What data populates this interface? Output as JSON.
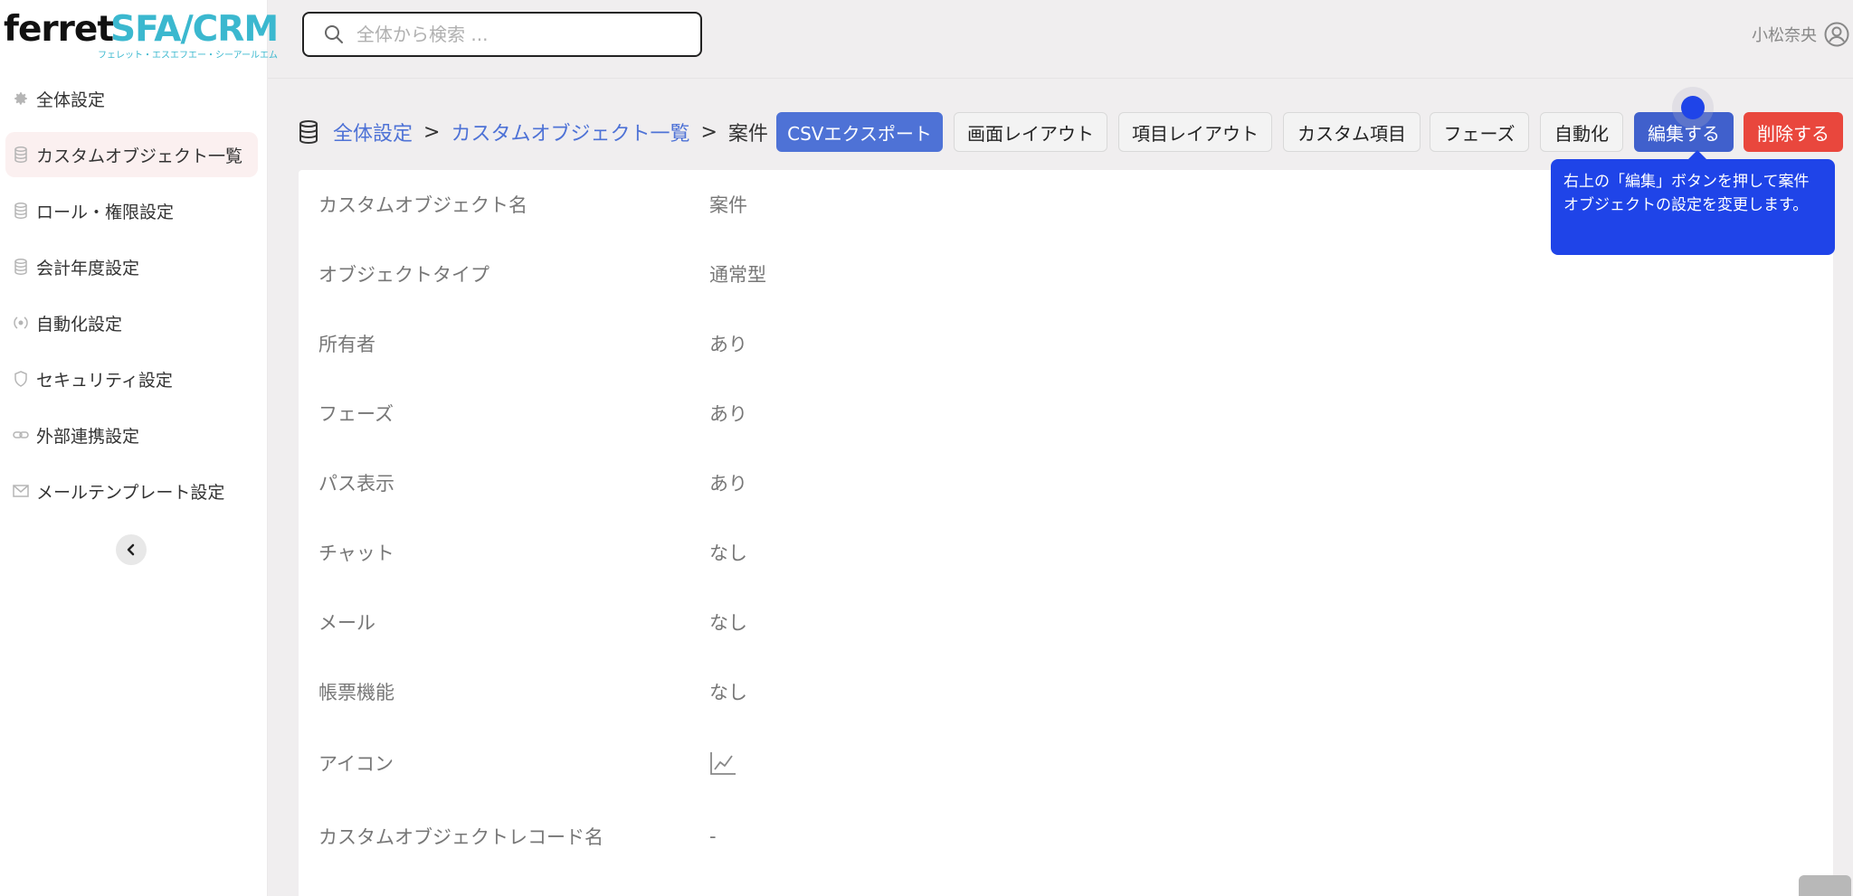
{
  "logo": {
    "brand": "ferret",
    "product": "SFA/CRM",
    "kana": "フェレット・エスエフエー・シーアールエム"
  },
  "sidebar": {
    "items": [
      {
        "label": "全体設定",
        "icon": "gear-icon"
      },
      {
        "label": "カスタムオブジェクト一覧",
        "icon": "database-icon"
      },
      {
        "label": "ロール・権限設定",
        "icon": "database-icon"
      },
      {
        "label": "会計年度設定",
        "icon": "database-icon"
      },
      {
        "label": "自動化設定",
        "icon": "automation-icon"
      },
      {
        "label": "セキュリティ設定",
        "icon": "shield-icon"
      },
      {
        "label": "外部連携設定",
        "icon": "link-icon"
      },
      {
        "label": "メールテンプレート設定",
        "icon": "mail-icon"
      }
    ],
    "active_index": 1
  },
  "search": {
    "placeholder": "全体から検索 ..."
  },
  "user": {
    "name": "小松奈央"
  },
  "breadcrumb": {
    "level1": "全体設定",
    "sep": ">",
    "level2": "カスタムオブジェクト一覧",
    "current": "案件"
  },
  "toolbar": {
    "csv_export": "CSVエクスポート",
    "screen_layout": "画面レイアウト",
    "field_layout": "項目レイアウト",
    "custom_fields": "カスタム項目",
    "phase": "フェーズ",
    "automation": "自動化",
    "edit": "編集する",
    "delete": "削除する"
  },
  "details": {
    "rows": [
      {
        "label": "カスタムオブジェクト名",
        "value": "案件"
      },
      {
        "label": "オブジェクトタイプ",
        "value": "通常型"
      },
      {
        "label": "所有者",
        "value": "あり"
      },
      {
        "label": "フェーズ",
        "value": "あり"
      },
      {
        "label": "パス表示",
        "value": "あり"
      },
      {
        "label": "チャット",
        "value": "なし"
      },
      {
        "label": "メール",
        "value": "なし"
      },
      {
        "label": "帳票機能",
        "value": "なし"
      },
      {
        "label": "アイコン",
        "value": "",
        "icon": "line-chart-icon"
      },
      {
        "label": "カスタムオブジェクトレコード名",
        "value": "-"
      }
    ]
  },
  "tooltip": {
    "text": "右上の「編集」ボタンを押して案件オブジェクトの設定を変更します。"
  },
  "colors": {
    "accent": "#4e72d6",
    "tooltip": "#1f44e8",
    "danger": "#e9473d",
    "brand_cyan": "#3bb8cf"
  }
}
